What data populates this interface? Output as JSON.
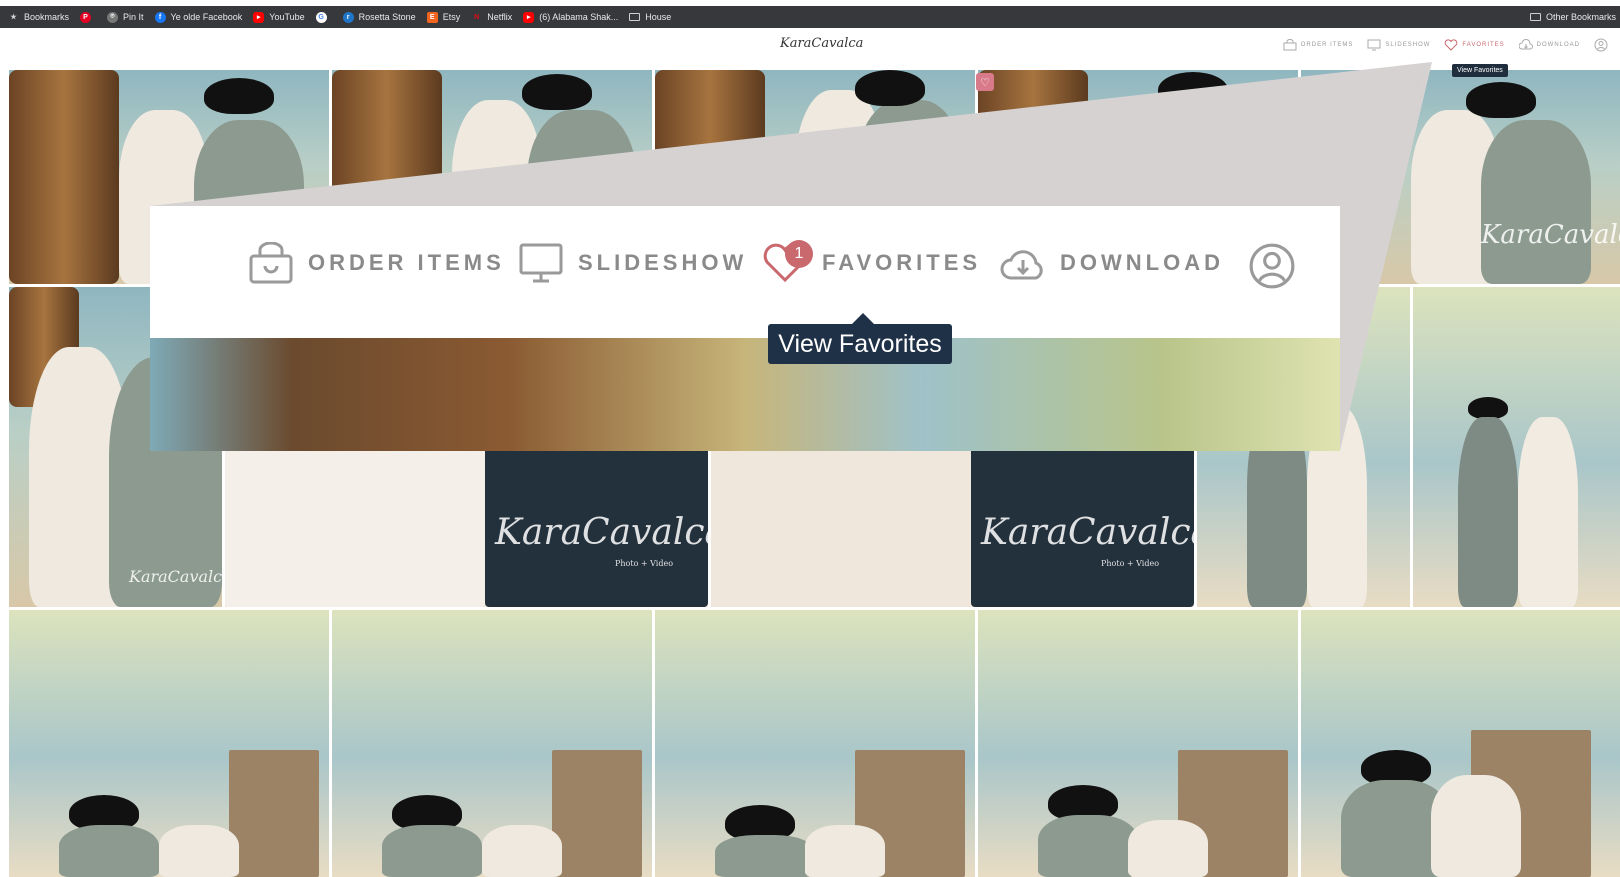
{
  "bookmarks": {
    "items": [
      {
        "label": "Bookmarks",
        "icon": "star-icon",
        "color": "#cfcfcf"
      },
      {
        "label": "",
        "icon": "pinterest-icon",
        "color": "#e60023"
      },
      {
        "label": "Pin It",
        "icon": "pin-icon",
        "color": "#bbbbbb"
      },
      {
        "label": "Ye olde Facebook",
        "icon": "facebook-icon",
        "color": "#1877f2"
      },
      {
        "label": "YouTube",
        "icon": "youtube-icon",
        "color": "#ff0000"
      },
      {
        "label": "",
        "icon": "google-icon",
        "color": "#ffffff"
      },
      {
        "label": "Rosetta Stone",
        "icon": "rosetta-stone-icon",
        "color": "#1f76c8"
      },
      {
        "label": "Etsy",
        "icon": "etsy-icon",
        "color": "#f1641e"
      },
      {
        "label": "Netflix",
        "icon": "netflix-icon",
        "color": "#e50914"
      },
      {
        "label": "(6) Alabama Shak...",
        "icon": "youtube-icon",
        "color": "#ff0000"
      },
      {
        "label": "House",
        "icon": "folder-icon",
        "color": "#cfcfcf"
      }
    ],
    "other": "Other Bookmarks"
  },
  "header": {
    "logo_text": "KaraCavalca",
    "nav": {
      "order_items": "ORDER ITEMS",
      "slideshow": "SLIDESHOW",
      "favorites": "FAVORITES",
      "download": "DOWNLOAD"
    },
    "favorites_count": "1",
    "tooltip": "View Favorites"
  },
  "zoom": {
    "order_items": "ORDER ITEMS",
    "slideshow": "SLIDESHOW",
    "favorites": "FAVORITES",
    "download": "DOWNLOAD",
    "favorites_count": "1",
    "tooltip": "View Favorites"
  },
  "gallery": {
    "watermark": "KaraCavalca",
    "watermark_sub": "Photo + Video"
  },
  "colors": {
    "accent": "#c9696e",
    "tooltip_bg": "#1f3146",
    "nav_text": "#8a8a8a",
    "bookmarks_bg": "#36383c"
  }
}
